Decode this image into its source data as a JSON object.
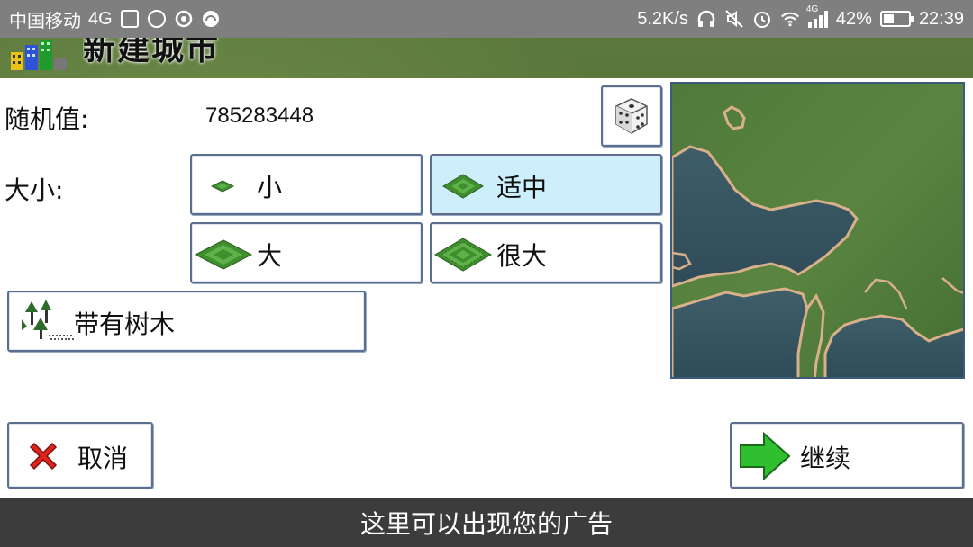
{
  "status_bar": {
    "carrier": "中国移动",
    "network": "4G",
    "net_speed": "5.2K/s",
    "battery_percent": "42%",
    "battery_level": 0.42,
    "time": "22:39",
    "signal_tag": "4G",
    "icons_left": [
      "image-icon",
      "alarm-icon",
      "weibo-icon",
      "headset-app-icon"
    ],
    "icons_right": [
      "headphones-icon",
      "mute-icon",
      "alarm-clock-icon",
      "wifi-icon",
      "signal-icon",
      "battery-icon"
    ]
  },
  "dialog": {
    "title": "新建城市",
    "seed_label": "随机值:",
    "seed_value": "785283448",
    "size_label": "大小:",
    "size_options": [
      {
        "label": "小",
        "selected": false
      },
      {
        "label": "适中",
        "selected": true
      },
      {
        "label": "大",
        "selected": false
      },
      {
        "label": "很大",
        "selected": false
      }
    ],
    "trees_label": "带有树木",
    "cancel_label": "取消",
    "continue_label": "继续"
  },
  "ad_bar": {
    "text": "这里可以出现您的广告"
  },
  "colors": {
    "selected_bg": "#cdeefb",
    "button_border": "#5a6e8f",
    "status_bar": "#7f7f7f",
    "ad_bar": "#3c3c3c",
    "cancel_x": "#e0241b",
    "continue_arrow": "#2fbf2f"
  }
}
